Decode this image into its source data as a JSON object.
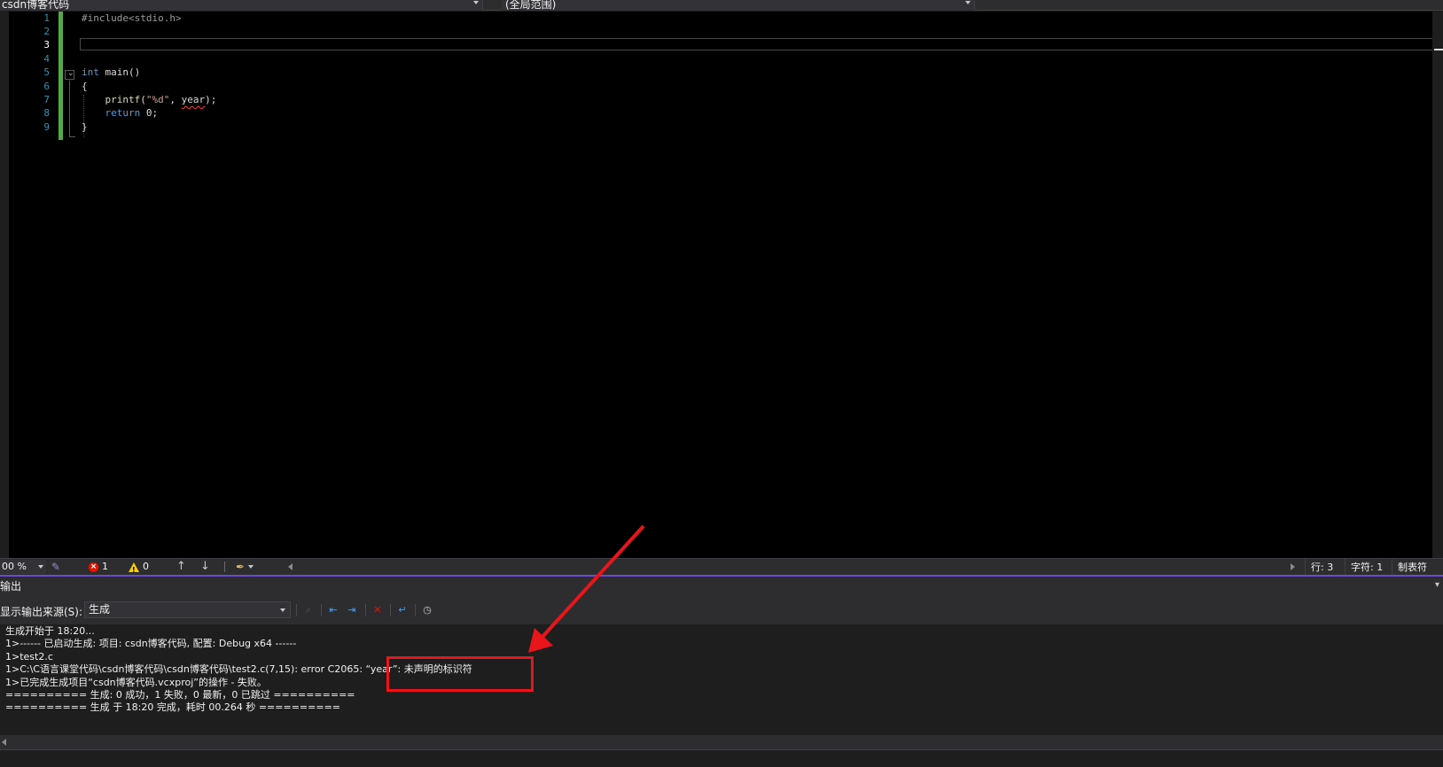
{
  "navbar": {
    "project": "csdn博客代码",
    "scope": "(全局范围)"
  },
  "editor": {
    "line_numbers": [
      "1",
      "2",
      "3",
      "4",
      "5",
      "6",
      "7",
      "8",
      "9"
    ],
    "current_line": 3,
    "code": {
      "l1_include": "#include<stdio.h>",
      "l5_type": "int",
      "l5_rest": " main()",
      "l6": "{",
      "l7_indent": "    ",
      "l7_fn": "printf",
      "l7_open": "(",
      "l7_str": "\"%d\"",
      "l7_comma": ", ",
      "l7_var": "year",
      "l7_close": ");",
      "l8_indent": "    ",
      "l8_kw": "return",
      "l8_rest": " 0;",
      "l9": "}"
    }
  },
  "status": {
    "zoom": "00 %",
    "errors": "1",
    "warnings": "0",
    "line": "行: 3",
    "char": "字符: 1",
    "tab": "制表符"
  },
  "output": {
    "title": "输出",
    "source_label": "显示输出来源(S):",
    "source_value": "生成",
    "lines": [
      "生成开始于 18:20...",
      "1>------ 已启动生成: 项目: csdn博客代码, 配置: Debug x64 ------",
      "1>test2.c",
      "1>C:\\C语言课堂代码\\csdn博客代码\\csdn博客代码\\test2.c(7,15): error C2065: “year”: 未声明的标识符",
      "1>已完成生成项目“csdn博客代码.vcxproj”的操作 - 失败。",
      "========== 生成: 0 成功，1 失败，0 最新，0 已跳过 ==========",
      "========== 生成 于 18:20 完成，耗时 00.264 秒 =========="
    ]
  },
  "annotation": {
    "color": "#e8161a"
  },
  "colors": {
    "keyword": "#569cd6",
    "string": "#d69d85",
    "function": "#dcdcaa",
    "line_number": "#2b91af",
    "change_bar": "#57a64a",
    "error_squiggle": "#ff3b3b",
    "output_tab_accent": "#6a4ec7"
  }
}
